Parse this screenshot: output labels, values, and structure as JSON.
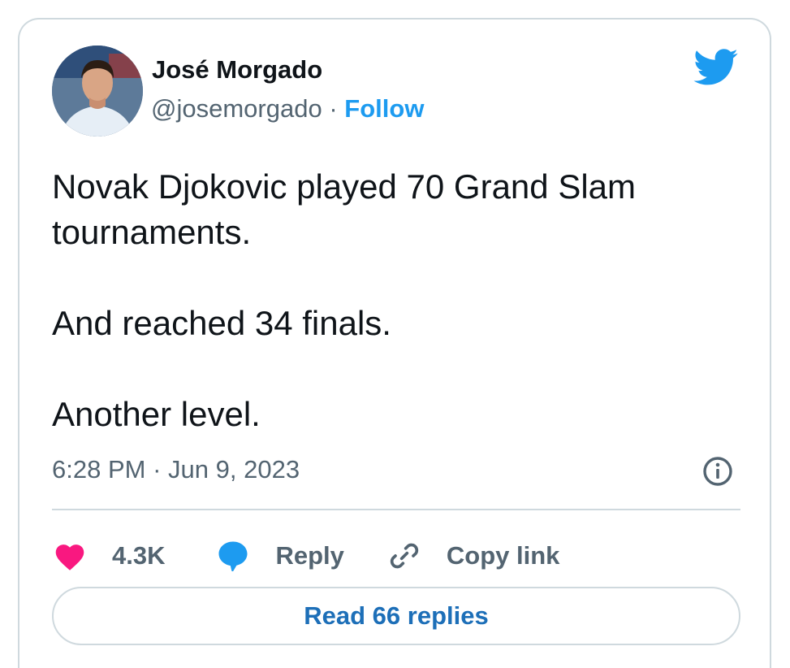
{
  "author": {
    "display_name": "José Morgado",
    "handle": "@josemorgado",
    "separator": "·",
    "follow_label": "Follow"
  },
  "tweet": {
    "paragraphs": [
      "Novak Djokovic played 70 Grand Slam tournaments.",
      "And reached 34 finals.",
      "Another level."
    ],
    "time": "6:28 PM",
    "separator": "·",
    "date": "Jun 9, 2023"
  },
  "actions": {
    "like_count": "4.3K",
    "reply_label": "Reply",
    "copy_link_label": "Copy link",
    "read_replies_label": "Read 66 replies"
  },
  "icons": {
    "brand": "twitter-bird-icon",
    "info": "info-icon",
    "like": "heart-icon",
    "reply": "speech-bubble-icon",
    "copy": "link-icon"
  },
  "colors": {
    "brand_blue": "#1d9bf0",
    "heart": "#f91880",
    "muted": "#536471",
    "border": "#cfd9de"
  }
}
